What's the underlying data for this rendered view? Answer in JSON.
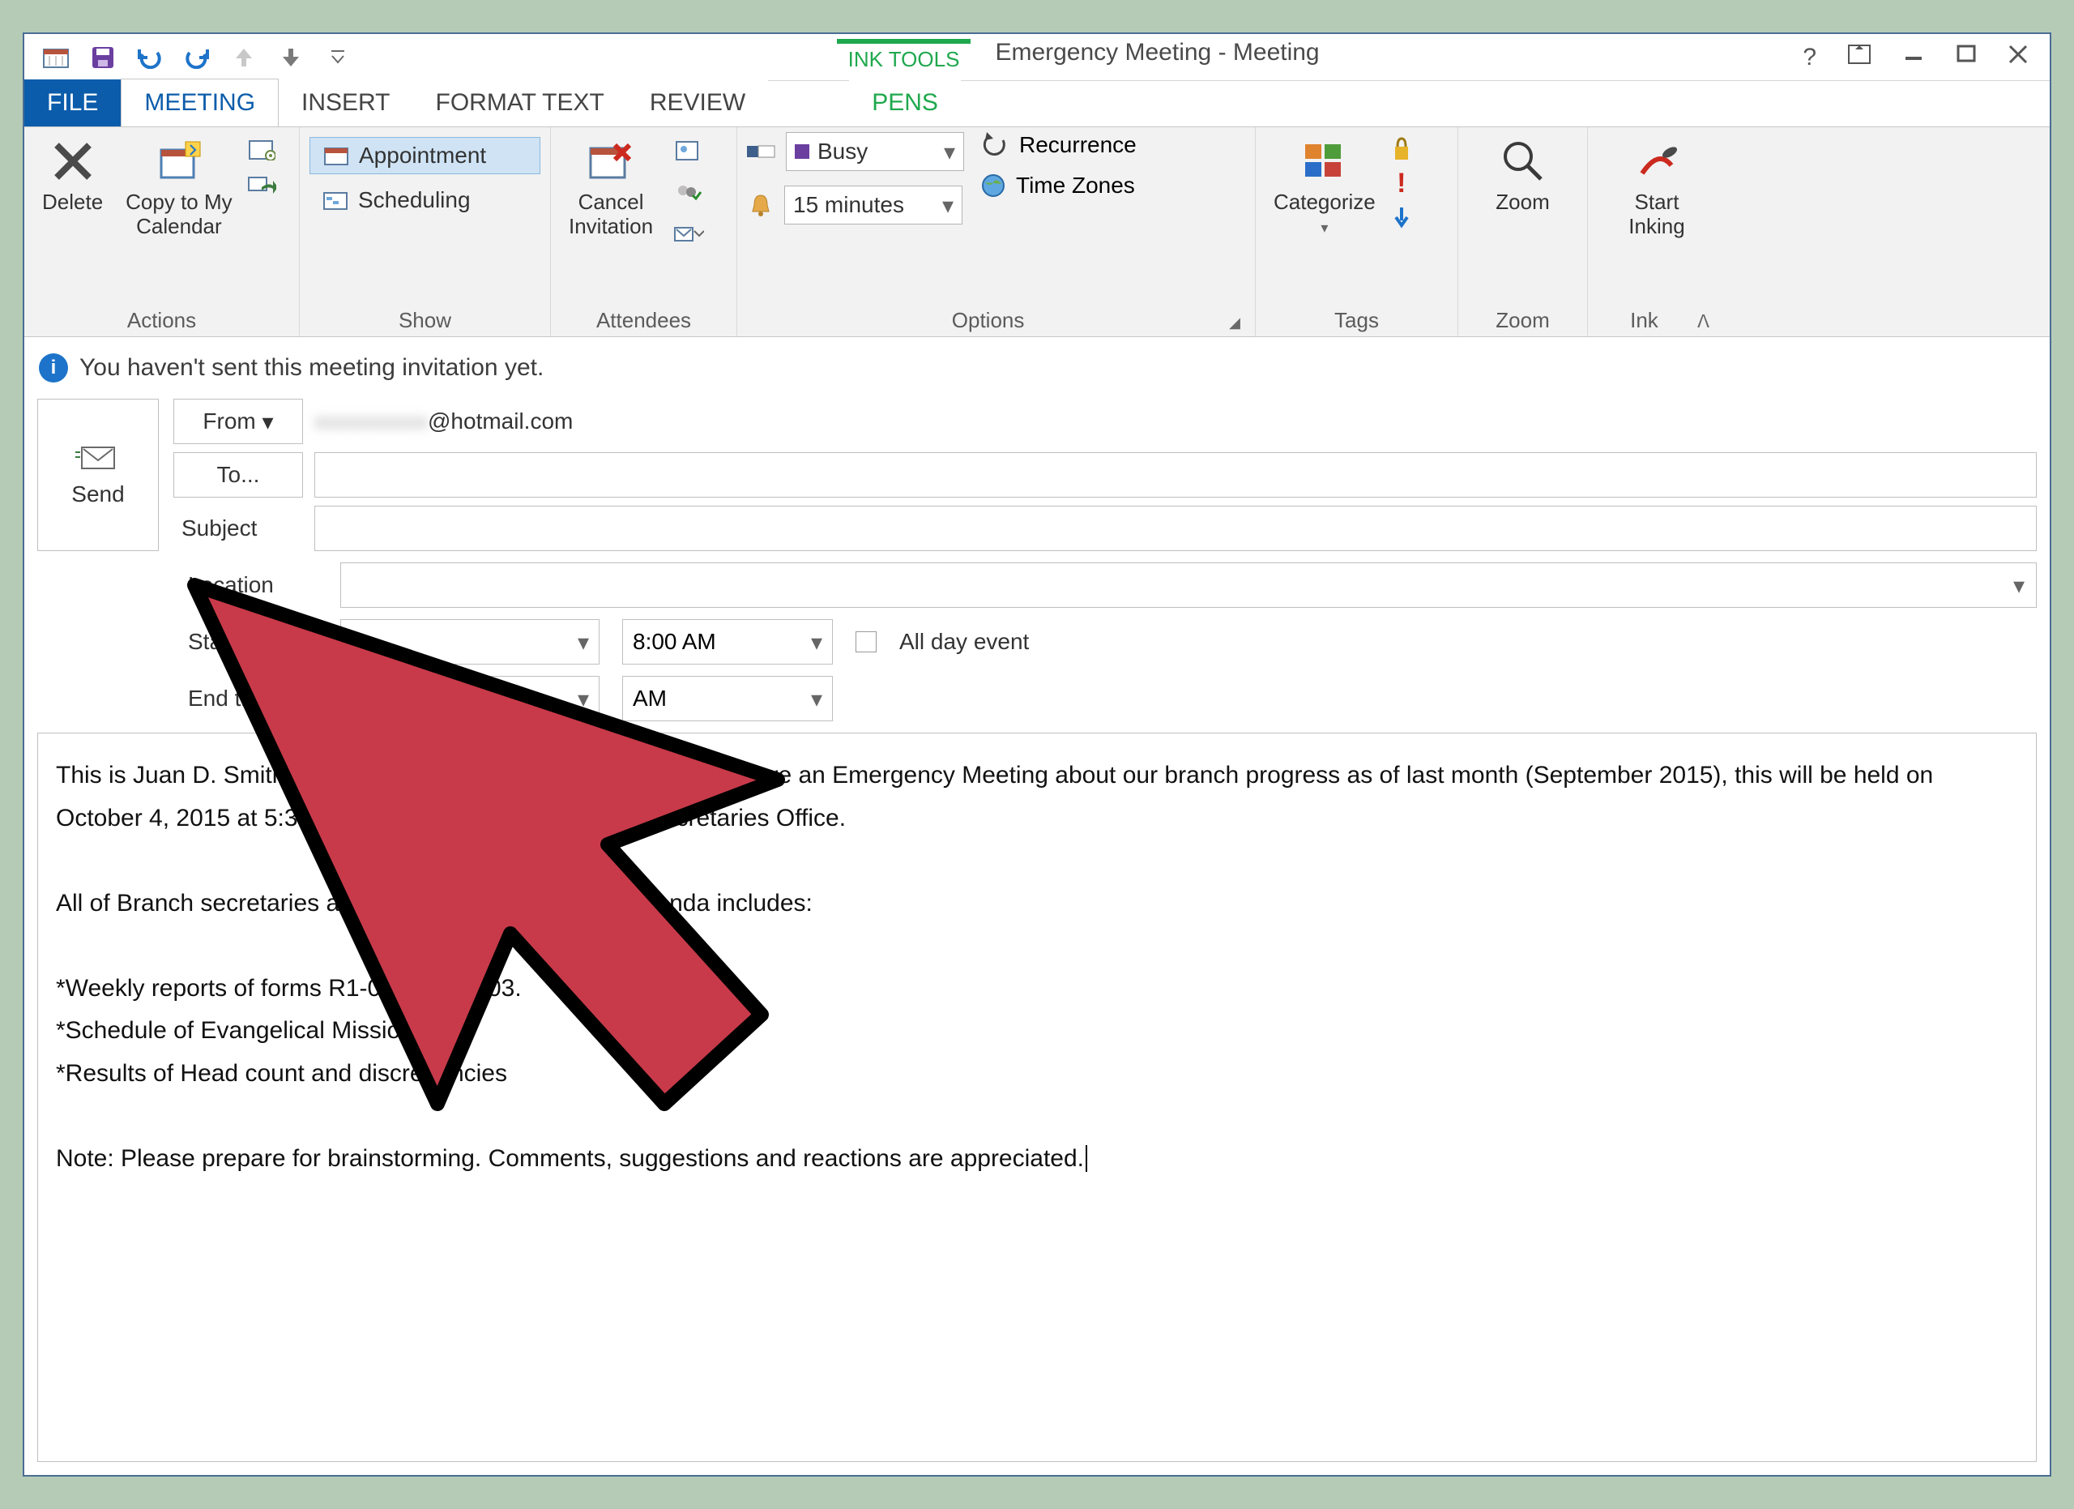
{
  "window": {
    "title": "Emergency Meeting - Meeting",
    "tool_tab": "INK TOOLS"
  },
  "tabs": {
    "file": "FILE",
    "meeting": "MEETING",
    "insert": "INSERT",
    "format_text": "FORMAT TEXT",
    "review": "REVIEW",
    "pens": "PENS"
  },
  "ribbon": {
    "actions": {
      "delete": "Delete",
      "copy": "Copy to My\nCalendar",
      "label": "Actions"
    },
    "show": {
      "appointment": "Appointment",
      "scheduling": "Scheduling",
      "label": "Show"
    },
    "attendees": {
      "cancel": "Cancel\nInvitation",
      "label": "Attendees"
    },
    "options": {
      "busy": "Busy",
      "reminder": "15 minutes",
      "recurrence": "Recurrence",
      "timezones": "Time Zones",
      "label": "Options"
    },
    "tags": {
      "categorize": "Categorize",
      "label": "Tags"
    },
    "zoom": {
      "zoom": "Zoom",
      "label": "Zoom"
    },
    "ink": {
      "start": "Start\nInking",
      "label": "Ink"
    }
  },
  "info_bar": "You haven't sent this meeting invitation yet.",
  "compose": {
    "send": "Send",
    "from_label": "From",
    "from_value": "@hotmail.com",
    "to_label": "To...",
    "subject_label": "Subject",
    "location_label": "Location",
    "start_label": "Start time",
    "end_label": "End time",
    "start_time": "8:00 AM",
    "end_time": "AM",
    "all_day": "All day event"
  },
  "body": {
    "p1": "This is Juan D. Smith Local Secretary of KHM Department. We have an Emergency Meeting about our branch progress as of last month (September 2015), this will be held on October 4, 2015 at 5:30 in the afternoon at our Branch Secretaries Office.",
    "p2": "All of Branch secretaries are expected to attend, Our agenda includes:",
    "b1": "*Weekly reports of forms R1-05 and R1-03.",
    "b2": "*Schedule of Evangelical Missions.",
    "b3": "*Results of Head count and discrepancies",
    "note": "Note: Please prepare for brainstorming. Comments, suggestions and reactions are appreciated."
  }
}
